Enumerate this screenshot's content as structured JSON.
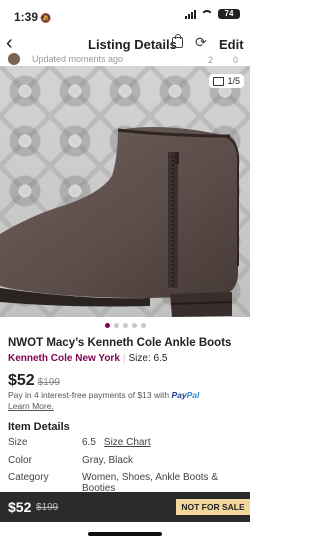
{
  "status_bar": {
    "time": "1:39",
    "battery": "74"
  },
  "nav": {
    "title": "Listing Details",
    "edit_label": "Edit"
  },
  "seller": {
    "updated_text": "Updated moments ago",
    "count_left": "2",
    "count_right": "0"
  },
  "gallery": {
    "counter": "1/5",
    "total_dots": 5,
    "active_dot": 1
  },
  "listing": {
    "title": "NWOT Macy’s Kenneth Cole Ankle Boots",
    "brand": "Kenneth Cole New York",
    "size_label": "Size: 6.5",
    "price": "$52",
    "original_price": "$199",
    "installment_text": "Pay in 4 interest-free payments of $13 with",
    "paypal_pay": "Pay",
    "paypal_pal": "Pal",
    "learn_more": "Learn More."
  },
  "details": {
    "header": "Item Details",
    "rows": [
      {
        "label": "Size",
        "value": "6.5",
        "link": "Size Chart"
      },
      {
        "label": "Color",
        "value": "Gray, Black"
      },
      {
        "label": "Category",
        "value": "Women, Shoes, Ankle Boots & Booties"
      }
    ]
  },
  "bottom_bar": {
    "price": "$52",
    "original_price": "$199",
    "status": "NOT FOR SALE"
  },
  "colors": {
    "accent": "#7f0353",
    "bar_bg": "#2b2b2b",
    "badge_bg": "#f1d79c",
    "paypal_blue": "#1f3b8e"
  },
  "icons": [
    "mute-icon",
    "signal-icon",
    "wifi-icon",
    "battery-icon",
    "back-chevron-icon",
    "shopping-bag-icon",
    "share-icon",
    "image-stack-icon"
  ]
}
